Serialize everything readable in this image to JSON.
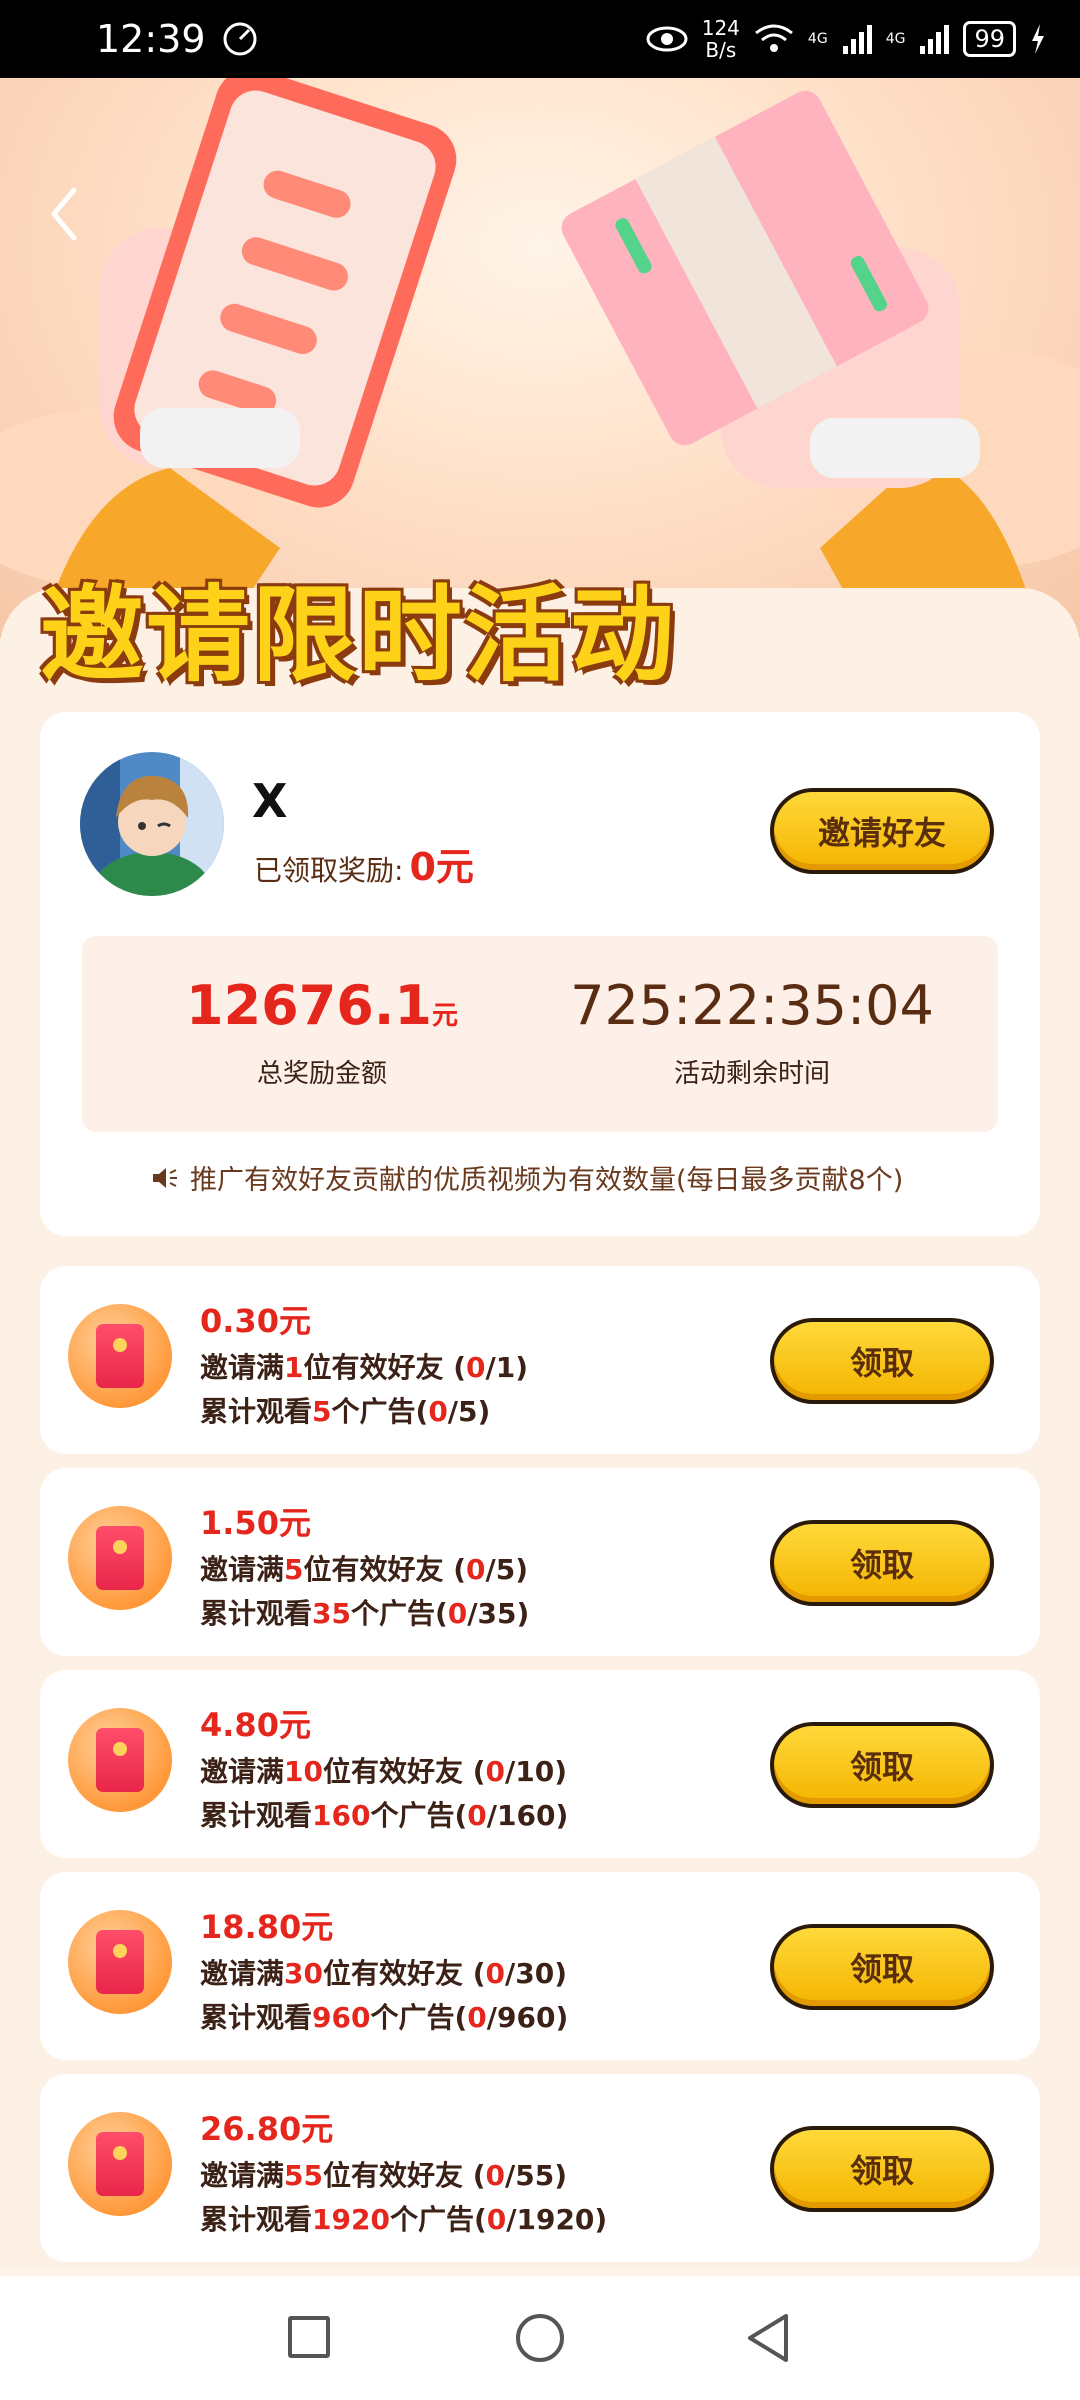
{
  "status_bar": {
    "time": "12:39",
    "net_speed_value": "124",
    "net_speed_unit": "B/s",
    "signal1_label": "4G",
    "signal2_label": "4G",
    "battery": "99"
  },
  "hero": {
    "title": "邀请限时活动",
    "back_icon": "chevron-left-icon"
  },
  "user": {
    "name": "X",
    "reward_label": "已领取奖励:",
    "reward_value": "0元",
    "invite_button": "邀请好友"
  },
  "stats": {
    "total_amount": "12676.1",
    "total_unit": "元",
    "total_label": "总奖励金额",
    "remaining_time": "725:22:35:04",
    "remaining_label": "活动剩余时间"
  },
  "notice": "推广有效好友贡献的优质视频为有效数量(每日最多贡献8个)",
  "tiers": [
    {
      "amount": "0.30元",
      "invite_prefix": "邀请满",
      "invite_count": "1",
      "invite_suffix": "位有效好友 (",
      "invite_done": "0",
      "invite_total": "/1)",
      "ad_prefix": "累计观看",
      "ad_count": "5",
      "ad_suffix": "个广告(",
      "ad_done": "0",
      "ad_total": "/5)",
      "button": "领取"
    },
    {
      "amount": "1.50元",
      "invite_prefix": "邀请满",
      "invite_count": "5",
      "invite_suffix": "位有效好友 (",
      "invite_done": "0",
      "invite_total": "/5)",
      "ad_prefix": "累计观看",
      "ad_count": "35",
      "ad_suffix": "个广告(",
      "ad_done": "0",
      "ad_total": "/35)",
      "button": "领取"
    },
    {
      "amount": "4.80元",
      "invite_prefix": "邀请满",
      "invite_count": "10",
      "invite_suffix": "位有效好友 (",
      "invite_done": "0",
      "invite_total": "/10)",
      "ad_prefix": "累计观看",
      "ad_count": "160",
      "ad_suffix": "个广告(",
      "ad_done": "0",
      "ad_total": "/160)",
      "button": "领取"
    },
    {
      "amount": "18.80元",
      "invite_prefix": "邀请满",
      "invite_count": "30",
      "invite_suffix": "位有效好友 (",
      "invite_done": "0",
      "invite_total": "/30)",
      "ad_prefix": "累计观看",
      "ad_count": "960",
      "ad_suffix": "个广告(",
      "ad_done": "0",
      "ad_total": "/960)",
      "button": "领取"
    },
    {
      "amount": "26.80元",
      "invite_prefix": "邀请满",
      "invite_count": "55",
      "invite_suffix": "位有效好友 (",
      "invite_done": "0",
      "invite_total": "/55)",
      "ad_prefix": "累计观看",
      "ad_count": "1920",
      "ad_suffix": "个广告(",
      "ad_done": "0",
      "ad_total": "/1920)",
      "button": "领取"
    }
  ],
  "colors": {
    "accent_red": "#e5261c",
    "button_yellow": "#f4b400",
    "title_yellow": "#ffd21a",
    "page_bg": "#fdf1e6"
  }
}
